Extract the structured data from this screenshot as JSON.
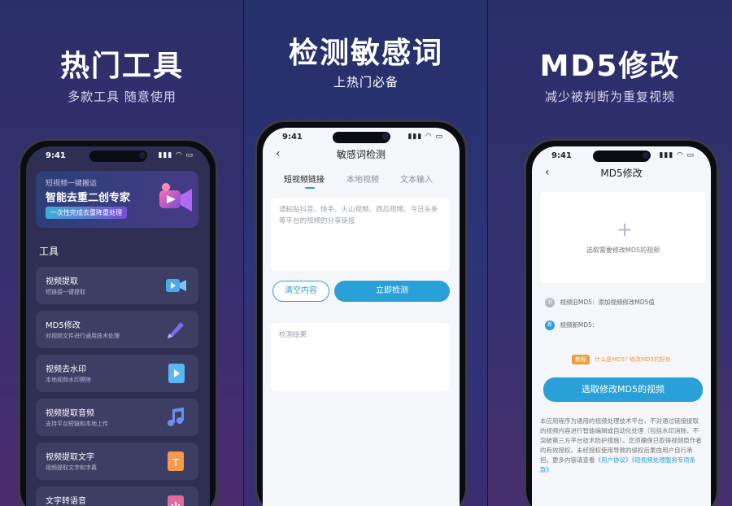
{
  "panels": [
    {
      "title": "热门工具",
      "subtitle": "多款工具 随意使用"
    },
    {
      "title": "检测敏感词",
      "subtitle": "上热门必备"
    },
    {
      "title": "MD5修改",
      "subtitle": "减少被判断为重复视频"
    }
  ],
  "status": {
    "time": "9:41"
  },
  "phone1": {
    "banner": {
      "small": "短视频一键搬运",
      "big": "智能去重二创专家",
      "pill": "一次性完成去重降重处理"
    },
    "section": "工具",
    "tools": [
      {
        "name": "视频提取",
        "desc": "短链接一键提取",
        "icon": "video-camera-icon",
        "color": "#4aa8ee"
      },
      {
        "name": "MD5修改",
        "desc": "对视频文件进行通用技术处理",
        "icon": "pencil-icon",
        "color": "#7d6cf0"
      },
      {
        "name": "视频去水印",
        "desc": "本地视频水印擦除",
        "icon": "play-file-icon",
        "color": "#59b7f3"
      },
      {
        "name": "视频提取音频",
        "desc": "支持平台短链和本地上传",
        "icon": "music-note-icon",
        "color": "#6f8ff0"
      },
      {
        "name": "视频提取文字",
        "desc": "视频提取文字和字幕",
        "icon": "text-file-icon",
        "color": "#f29b4e"
      },
      {
        "name": "文字转语音",
        "desc": "",
        "icon": "audio-file-icon",
        "color": "#e56aa0"
      }
    ]
  },
  "phone2": {
    "title": "敏感词检测",
    "tabs": [
      "短视频链接",
      "本地视频",
      "文本输入"
    ],
    "placeholder": "请粘贴抖音、快手、火山视频、西瓜视频、今日头条等平台的视频的分享链接",
    "clear_label": "清空内容",
    "detect_label": "立即检测",
    "result_label": "检测结果"
  },
  "phone3": {
    "title": "MD5修改",
    "pick_label": "选取需要修改MD5的视频",
    "old_label": "视频旧MD5：添加视频修改MD5值",
    "old_badge": "旧",
    "new_label": "视频新MD5：",
    "new_badge": "新",
    "tutorial_tag": "教程",
    "tutorial_link": "什么是MD5? 修改MD5的好处",
    "select_button": "选取修改MD5的视频",
    "disclaimer": "本应用程序为通用的视频处理技术平台，不对通过链接提取的视频内容进行智能编辑或自动化处理（包括水印消除、不突破第三方平台技术防护措施）。您须确保已取得视频原作者的有效授权。未经授权使用导致的侵权后果由用户自行承担。更多内容请查看",
    "link1": "《用户协议》",
    "link2": "《短视频处理服务专项条款》"
  }
}
